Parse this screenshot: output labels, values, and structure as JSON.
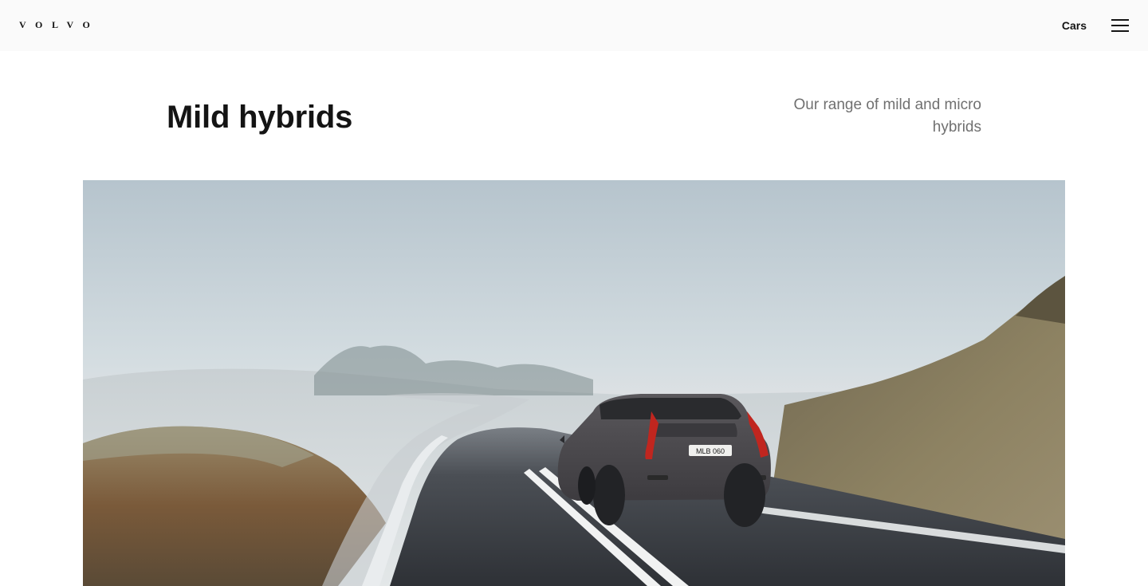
{
  "header": {
    "logo_text": "VOLVO",
    "nav_cars_label": "Cars",
    "menu_icon": "hamburger-menu-icon"
  },
  "hero": {
    "title": "Mild hybrids",
    "subtitle": "Our range of mild and micro hybrids",
    "image": {
      "license_plate": "MLB 060",
      "description_icon": "car-on-road-image"
    }
  },
  "colors": {
    "topbar_bg": "#fafafa",
    "title_text": "#141414",
    "subtitle_text": "#707070",
    "sky_top": "#b8c6cf",
    "road": "#3a3d42",
    "car_body": "#4e4c50",
    "tail_light": "#c0261f"
  }
}
